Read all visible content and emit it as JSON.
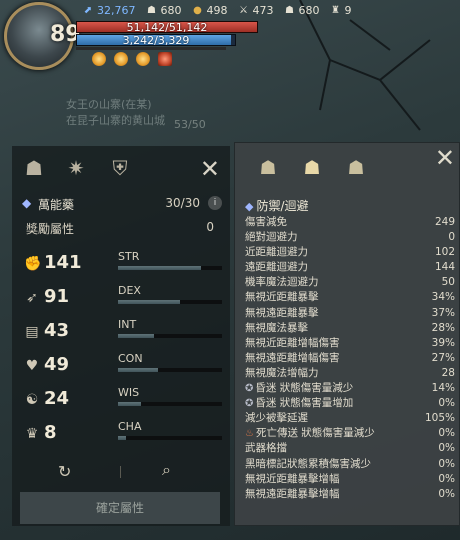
{
  "hud": {
    "level": "89",
    "currencies": [
      {
        "icon": "gem-icon",
        "glyph": "⬈",
        "value": "32,767"
      },
      {
        "icon": "helmet-icon",
        "glyph": "☗",
        "value": "680"
      },
      {
        "icon": "coin-icon",
        "glyph": "●",
        "value": "498"
      },
      {
        "icon": "sword-icon",
        "glyph": "⚔",
        "value": "473"
      },
      {
        "icon": "helmet-icon-2",
        "glyph": "☗",
        "value": "680"
      },
      {
        "icon": "trophy-icon",
        "glyph": "♜",
        "value": "9"
      }
    ],
    "hp": {
      "text": "51,142/51,142",
      "fraction": 1.0
    },
    "mp": {
      "text": "3,242/3,329",
      "fraction": 0.974
    }
  },
  "background": {
    "quest_line1": "女王の山寨(在某)",
    "quest_line2": "在昆子山寨的黄山城",
    "quest_count": "53/50"
  },
  "left_panel": {
    "elixir_label": "萬能藥",
    "elixir_value": "30/30",
    "bonus_label": "獎勵屬性",
    "bonus_value": "0",
    "stats": [
      {
        "icon": "str-icon",
        "glyph": "✊",
        "value": "141",
        "abbr": "STR",
        "fill": 0.8
      },
      {
        "icon": "dex-icon",
        "glyph": "➶",
        "value": "91",
        "abbr": "DEX",
        "fill": 0.6
      },
      {
        "icon": "int-icon",
        "glyph": "📖",
        "value": "43",
        "abbr": "INT",
        "fill": 0.35
      },
      {
        "icon": "con-icon",
        "glyph": "♥",
        "value": "49",
        "abbr": "CON",
        "fill": 0.38
      },
      {
        "icon": "wis-icon",
        "glyph": "☯",
        "value": "24",
        "abbr": "WIS",
        "fill": 0.22
      },
      {
        "icon": "cha-icon",
        "glyph": "♛",
        "value": "8",
        "abbr": "CHA",
        "fill": 0.08
      }
    ],
    "confirm_label": "確定屬性"
  },
  "right_panel": {
    "title": "防禦/迴避",
    "rows": [
      {
        "label": "傷害減免",
        "value": "249"
      },
      {
        "label": "絕對迴避力",
        "value": "0"
      },
      {
        "label": "近距離迴避力",
        "value": "102"
      },
      {
        "label": "遠距離迴避力",
        "value": "144"
      },
      {
        "label": "機率魔法迴避力",
        "value": "50"
      },
      {
        "label": "無視近距離暴擊",
        "value": "34%"
      },
      {
        "label": "無視遠距離暴擊",
        "value": "37%"
      },
      {
        "label": "無視魔法暴擊",
        "value": "28%"
      },
      {
        "label": "無視近距離增幅傷害",
        "value": "39%"
      },
      {
        "label": "無視遠距離增幅傷害",
        "value": "27%"
      },
      {
        "label": "無視魔法增幅力",
        "value": "28"
      },
      {
        "label": "昏迷 狀態傷害量減少",
        "value": "14%",
        "icon": "stun-icon"
      },
      {
        "label": "昏迷 狀態傷害量增加",
        "value": "0%",
        "icon": "stun-icon"
      },
      {
        "label": "減少被擊延遲",
        "value": "105%"
      },
      {
        "label": "死亡傳送 狀態傷害量減少",
        "value": "0%",
        "icon": "fire-icon"
      },
      {
        "label": "武器格擋",
        "value": "0%"
      },
      {
        "label": "黑暗標記狀態累積傷害減少",
        "value": "0%"
      },
      {
        "label": "無視近距離暴擊增幅",
        "value": "0%"
      },
      {
        "label": "無視遠距離暴擊增幅",
        "value": "0%"
      }
    ]
  }
}
